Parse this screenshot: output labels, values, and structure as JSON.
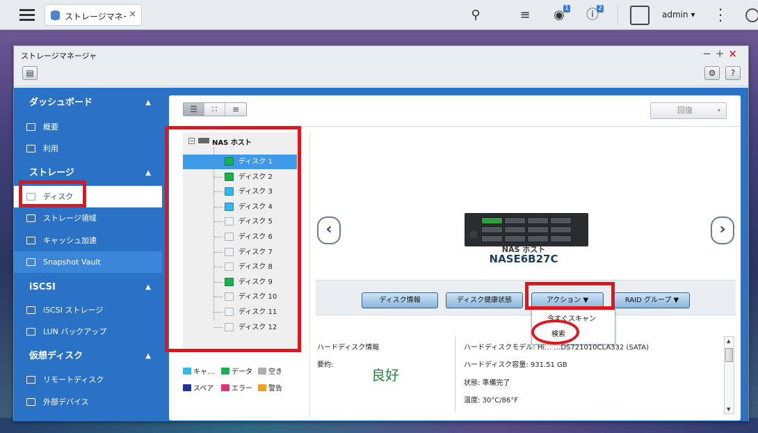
{
  "taskbar": {
    "tab_label": "ストレージマネー…",
    "tab_close": "×",
    "notif_badge_1": "1",
    "notif_badge_2": "2",
    "user": "admin",
    "user_caret": "▾"
  },
  "window": {
    "title": "ストレージマネージャ",
    "controls": {
      "minimize": "−",
      "maximize": "+",
      "close": "×"
    },
    "gear": "⚙",
    "help": "?"
  },
  "sidebar": {
    "sections": [
      {
        "label": "ダッシュボード",
        "items": [
          "概要",
          "利用"
        ]
      },
      {
        "label": "ストレージ",
        "items": [
          "ディスク",
          "ストレージ領域",
          "キャッシュ加速",
          "Snapshot Vault"
        ]
      },
      {
        "label": "iSCSI",
        "items": [
          "iSCSI ストレージ",
          "LUN バックアップ"
        ]
      },
      {
        "label": "仮想ディスク",
        "items": [
          "リモートディスク",
          "外部デバイス"
        ]
      }
    ],
    "active_item": "ディスク",
    "hovered_item": "Snapshot Vault",
    "chevron": "▲"
  },
  "toolbar": {
    "view_buttons": [
      "list-view",
      "grid-view",
      "detail-view"
    ],
    "recover_label": "回復",
    "recover_caret": "▾"
  },
  "tree": {
    "root_label": "NAS ホスト",
    "root_toggle": "⊟",
    "disks": [
      {
        "label": "ディスク 1",
        "status": "data",
        "selected": true
      },
      {
        "label": "ディスク 2",
        "status": "data"
      },
      {
        "label": "ディスク 3",
        "status": "cache"
      },
      {
        "label": "ディスク 4",
        "status": "cache"
      },
      {
        "label": "ディスク 5",
        "status": "empty"
      },
      {
        "label": "ディスク 6",
        "status": "empty"
      },
      {
        "label": "ディスク 7",
        "status": "empty"
      },
      {
        "label": "ディスク 8",
        "status": "empty"
      },
      {
        "label": "ディスク 9",
        "status": "data"
      },
      {
        "label": "ディスク 10",
        "status": "empty"
      },
      {
        "label": "ディスク 11",
        "status": "empty"
      },
      {
        "label": "ディスク 12",
        "status": "empty"
      }
    ]
  },
  "legend": [
    {
      "label": "キャ…",
      "color": "#30b9ea"
    },
    {
      "label": "データ",
      "color": "#18b34c"
    },
    {
      "label": "空き",
      "color": "#a8b0b6"
    },
    {
      "label": "スペア",
      "color": "#23319c"
    },
    {
      "label": "エラー",
      "color": "#e2336f"
    },
    {
      "label": "警告",
      "color": "#f0a21a"
    }
  ],
  "device": {
    "nav_prev": "‹",
    "nav_next": "›",
    "label": "NAS ホスト",
    "name": "NASE6B27C"
  },
  "actions": {
    "disk_info": "ディスク情報",
    "disk_health": "ディスク健康状態",
    "action": "アクション ▼",
    "raid_group": "RAID グループ ▼",
    "menu": [
      "今すぐスキャン",
      "検索"
    ]
  },
  "info": {
    "section_title": "ハードディスク情報",
    "summary_label": "要約:",
    "summary_value": "良好",
    "model": "ハードディスクモデル: Hi…  …DS721010CLA332 (SATA)",
    "capacity": "ハードディスク容量: 931.51 GB",
    "status": "状態: 準備完了",
    "temperature": "温度: 30°C/86°F"
  },
  "colors": {
    "sidebar_bg": "#2a72c6",
    "selection": "#3e9ae8",
    "annotation_red": "#e3141a",
    "good_green": "#1a8a3a"
  }
}
